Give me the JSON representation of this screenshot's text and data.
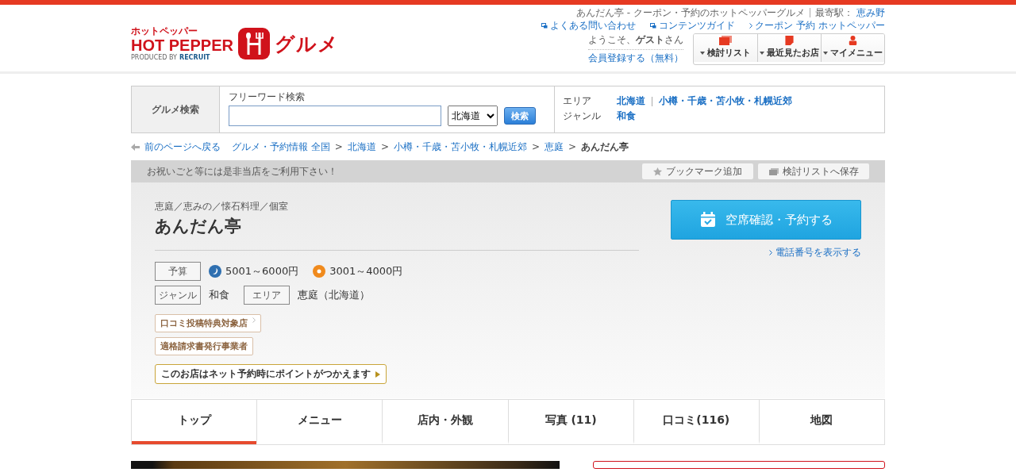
{
  "header": {
    "logo": {
      "kana": "ホットペッパー",
      "brand": "HOT PEPPER",
      "produced_by": "PRODUCED BY",
      "recruit": "RECRUIT",
      "gourmet": "グルメ"
    },
    "page_title": "あんだん亭 - クーポン・予約のホットペッパーグルメ",
    "station_label": "最寄駅：",
    "station": "恵み野",
    "links": [
      {
        "kind": "window",
        "label": "よくある問い合わせ"
      },
      {
        "kind": "window",
        "label": "コンテンツガイド"
      },
      {
        "kind": "arrow",
        "label": "クーポン 予約 ホットペッパー"
      }
    ],
    "welcome": "ようこそ、**ゲスト**さん",
    "register": "会員登録する（無料）",
    "menu_buttons": [
      {
        "kind": "list",
        "label": "検討リスト"
      },
      {
        "kind": "recent",
        "label": "最近見たお店"
      },
      {
        "kind": "user",
        "label": "マイメニュー"
      }
    ]
  },
  "search": {
    "label": "グルメ検索",
    "freeword_label": "フリーワード検索",
    "region": "北海道",
    "button": "検索",
    "area_label": "エリア",
    "areas": [
      "北海道",
      "小樽・千歳・苫小牧・札幌近郊"
    ],
    "genre_label": "ジャンル",
    "genre": "和食"
  },
  "breadcrumb": {
    "back": "前のページへ戻る",
    "items": [
      "グルメ・予約情報 全国",
      "北海道",
      "小樽・千歳・苫小牧・札幌近郊",
      "恵庭"
    ],
    "separator": ">",
    "current": "あんだん亭"
  },
  "notice": {
    "text": "お祝いごと等には是非当店をご利用下さい！",
    "actions": [
      {
        "kind": "bookmark",
        "label": "ブックマーク追加"
      },
      {
        "kind": "list",
        "label": "検討リストへ保存"
      }
    ]
  },
  "shop": {
    "categories": "恵庭／恵みの／懐石料理／個室",
    "name": "あんだん亭",
    "budget_label": "予算",
    "budgets": [
      {
        "kind": "dinner",
        "text": "5001～6000円"
      },
      {
        "kind": "lunch",
        "text": "3001～4000円"
      }
    ],
    "genre_label": "ジャンル",
    "genre": "和食",
    "area_label": "エリア",
    "area": "恵庭（北海道）",
    "badges": [
      {
        "label": "口コミ投稿特典対象店",
        "arrow": true
      },
      {
        "label": "適格請求書発行事業者",
        "arrow": false
      }
    ],
    "point_banner": "このお店はネット予約時にポイントがつかえます",
    "reserve_button": "空席確認・予約する",
    "phone_link": "電話番号を表示する"
  },
  "tabs": [
    {
      "label": "トップ",
      "selected": true
    },
    {
      "label": "メニュー",
      "selected": false
    },
    {
      "label": "店内・外観",
      "selected": false
    },
    {
      "label": "写真 (11)",
      "selected": false
    },
    {
      "label": "口コミ(116)",
      "selected": false
    },
    {
      "label": "地図",
      "selected": false
    }
  ]
}
